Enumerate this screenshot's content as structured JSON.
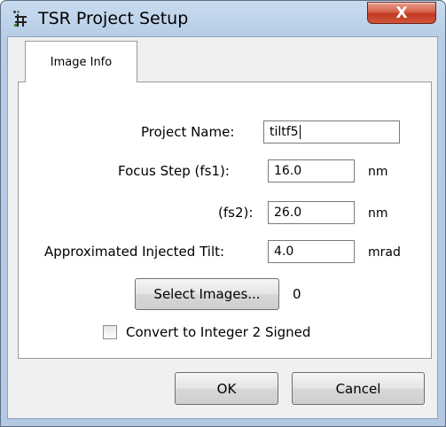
{
  "window": {
    "title": "TSR Project Setup",
    "close_symbol": "X"
  },
  "tabs": [
    {
      "label": "Image Info",
      "selected": true
    }
  ],
  "form": {
    "project_name": {
      "label": "Project Name:",
      "value": "tiltf5"
    },
    "focus_step_fs1": {
      "label": "Focus Step (fs1):",
      "value": "16.0",
      "unit": "nm"
    },
    "focus_step_fs2": {
      "label": "(fs2):",
      "value": "26.0",
      "unit": "nm"
    },
    "injected_tilt": {
      "label": "Approximated Injected Tilt:",
      "value": "4.0",
      "unit": "mrad"
    },
    "select_images": {
      "label": "Select Images...",
      "count": "0"
    },
    "convert_checkbox": {
      "label": "Convert to Integer 2 Signed",
      "checked": false
    }
  },
  "footer": {
    "ok_label": "OK",
    "cancel_label": "Cancel"
  },
  "colors": {
    "frame": "#b7cde6",
    "close_button": "#c7442b",
    "client": "#f0f0f0"
  }
}
